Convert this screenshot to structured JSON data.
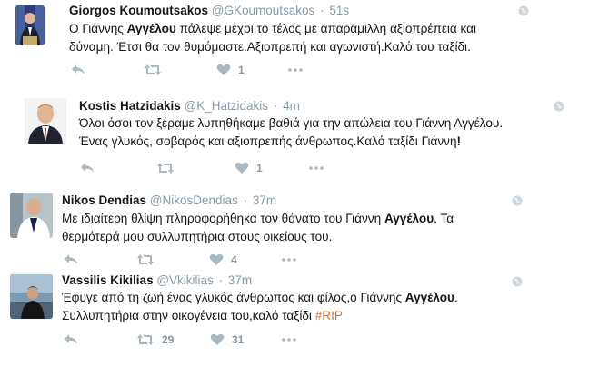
{
  "tweets": [
    {
      "name": "Giorgos Koumoutsakos",
      "handle": "@GKoumoutsakos",
      "time": "51s",
      "text_parts": [
        "Ο Γιάννης ",
        "Αγγέλου",
        " πάλεψε μέχρι το τέλος με απαράμιλλη αξιοπρέπεια και\nδύναμη. Έτσι θα τον θυμόμαστε.Αξιοπρεπή και αγωνιστή.Καλό του ταξίδι.",
        "",
        ""
      ],
      "retweets": "",
      "likes": "1"
    },
    {
      "name": "Kostis Hatzidakis",
      "handle": "@K_Hatzidakis",
      "time": "4m",
      "text_parts": [
        "Όλοι όσοι τον ξέραμε λυπηθήκαμε βαθιά για την απώλεια του Γιάννη Αγγέλου.\nΈνας γλυκός, σοβαρός και αξιοπρεπής άνθρωπος.Καλό ταξίδι Γιάννη",
        "!",
        "",
        "",
        ""
      ],
      "retweets": "",
      "likes": "1"
    },
    {
      "name": "Nikos Dendias",
      "handle": "@NikosDendias",
      "time": "37m",
      "text_parts": [
        "Με ιδιαίτερη θλίψη πληροφορήθηκα τον θάνατο του Γιάννη ",
        "Αγγέλου",
        ". Τα\nθερμότερά μου συλλυπητήρια στους οικείους του.",
        "",
        ""
      ],
      "retweets": "",
      "likes": "4"
    },
    {
      "name": "Vassilis Kikilias",
      "handle": "@Vkikilias",
      "time": "37m",
      "text_parts": [
        "Έφυγε από τη ζωή ένας γλυκός άνθρωπος και φίλος,ο Γιάννης ",
        "Αγγέλου",
        ".\nΣυλλυπητήρια στην οικογένεια του,καλό ταξίδι ",
        "",
        "#RIP"
      ],
      "retweets": "29",
      "likes": "31"
    }
  ],
  "icons": {
    "reply": "reply-icon",
    "retweet": "retweet-icon",
    "like": "heart-icon",
    "more": "more-icon",
    "globe": "globe-icon"
  },
  "colors": {
    "hashtag": "#e0712c",
    "icon_gray": "#aab8c2",
    "meta_gray": "#8899a6"
  }
}
